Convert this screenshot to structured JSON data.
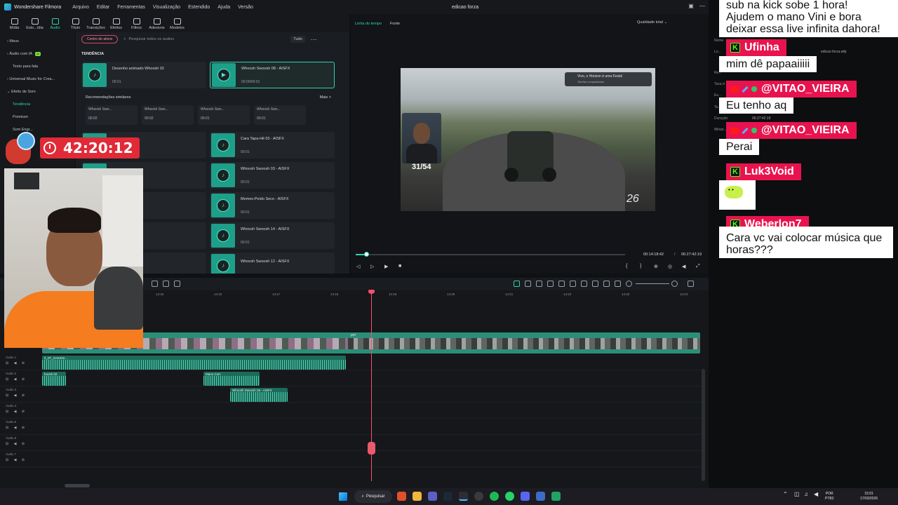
{
  "titlebar": {
    "app_name": "Wonder­share Filmora",
    "menu": [
      "Arquivo",
      "Editar",
      "Ferramentas",
      "Visualização",
      "Estendido",
      "Ajuda",
      "Versão"
    ],
    "document_title": "edicao forza"
  },
  "toolbar": {
    "items": [
      "Mídia",
      "Esto...ídia",
      "Áudio",
      "Título",
      "Transições",
      "Efeitos",
      "Filtros",
      "Adesivos",
      "Modelos"
    ],
    "active": "Áudio"
  },
  "leftnav": {
    "items": [
      "Meus",
      "Áudio com IA",
      "Texto para fala",
      "Universal Music for Crea...",
      "Efeito de Som",
      "Tendência",
      "Premium",
      "Som Engr..."
    ],
    "ai_badge": "AI"
  },
  "assets": {
    "center_button": "Centro de ativos",
    "search_placeholder": "Pesquisar todos os áudios",
    "filter": "Tudo",
    "section": "TENDÊNCIA",
    "top_cards": [
      {
        "title": "Desenho animado Whoosh 02",
        "duration": "00:01"
      },
      {
        "title": "Whoosh Swoosh 08 - AISFX",
        "duration": "00:00/00:01"
      }
    ],
    "similar_title": "Recomendações similares",
    "similar_more": "Mais >",
    "similar": [
      {
        "title": "Whoosh Swo...",
        "duration": "00:02"
      },
      {
        "title": "Whoosh Swo...",
        "duration": "00:02"
      },
      {
        "title": "Whoosh Swo...",
        "duration": "00:01"
      },
      {
        "title": "Whoosh Swo...",
        "duration": "00:01"
      }
    ],
    "left_list": [
      {
        "title": "- AISFX",
        "duration": ""
      },
      {
        "title": "sh 06 - AISFX",
        "duration": ""
      },
      {
        "title": "Grito - AISFX",
        "duration": ""
      },
      {
        "title": "- AISFX",
        "duration": ""
      },
      {
        "title": "m - AISFX",
        "duration": ""
      }
    ],
    "right_list": [
      {
        "title": "Cara Tapa-Hit 03 - AISFX",
        "duration": "00:01"
      },
      {
        "title": "Whoosh Swoosh 03 - AISFX",
        "duration": "00:01"
      },
      {
        "title": "Memes-Peido Seco - AISFX",
        "duration": "00:01"
      },
      {
        "title": "Whoosh Swoosh 14 - AISFX",
        "duration": "00:01"
      },
      {
        "title": "Whoosh Swoosh 12 - AISFX",
        "duration": ""
      }
    ]
  },
  "preview": {
    "tabs": [
      "Linha do tempo",
      "Fonte"
    ],
    "quality": "Qualidade total",
    "notification_title": "Vivo, o Horizon é uma Festa!",
    "notification_sub": "Tarefas conquistadas",
    "counter": "31/54",
    "speed": "26",
    "current_time": "00:14:18:42",
    "separator": "/",
    "total_time": "06:27:42:19",
    "progress": 0.04
  },
  "timeline": {
    "ruler": [
      "14:15",
      "14:16",
      "14:17",
      "14:18",
      "14:19",
      "14:20",
      "14:21",
      "14:22",
      "14:23",
      "14:24"
    ],
    "video_clip_label": "p07",
    "audio_tracks": [
      "Áudio 1",
      "Áudio 2",
      "Áudio 3",
      "Áudio 4",
      "Áudio 5",
      "Áudio 6",
      "Áudio 7"
    ],
    "audio_clips": [
      {
        "label": "0_0T_SAE402...",
        "track": 1
      },
      {
        "label": "hoosh 02",
        "track": 2
      },
      {
        "label": "Mario Coin",
        "track": 2
      },
      {
        "label": "Whoosh Swoosh 26 - AISFX",
        "track": 3
      }
    ]
  },
  "overlay": {
    "timer": "42:20:12"
  },
  "properties": {
    "rows": [
      {
        "label": "Nome",
        "value": ""
      },
      {
        "label": "Lo...",
        "value": "edicao forza.wfp"
      },
      {
        "label": "Re...",
        "value": ""
      },
      {
        "label": "Taxa d",
        "value": ""
      },
      {
        "label": "Es...",
        "value": ""
      },
      {
        "label": "Ta...",
        "value": "06:27:42:19"
      },
      {
        "label": "Duração:",
        "value": "06:27:42:19"
      },
      {
        "label": "Miniat...",
        "value": ""
      }
    ]
  },
  "chat": {
    "top_text": "sub na kick sobe 1 hora!\nAjudem o mano Vini e bora\ndeixar essa live infinita dahora!",
    "messages": [
      {
        "name": "Ufinha",
        "platform": "kick",
        "text": "mim dê papaaiiiii"
      },
      {
        "name": "@VITAO_VIEIRA",
        "platform": "youtube",
        "text": "Eu tenho aq"
      },
      {
        "name": "@VITAO_VIEIRA",
        "platform": "youtube",
        "text": "Perai"
      },
      {
        "name": "Luk3Void",
        "platform": "kick",
        "text": ""
      },
      {
        "name": "Weberlon7",
        "platform": "kick",
        "text": "Cara vc vai colocar música que\nhoras???"
      }
    ]
  },
  "taskbar": {
    "search": "Pesquisar",
    "lang": "POR",
    "layout": "PTB2",
    "time": "15:01",
    "date": "17/03/2026"
  },
  "colors": {
    "accent": "#2fd3b0",
    "chat_name_bg": "#e8134e",
    "timer_bg": "#e12a37",
    "playhead": "#ff4d6a"
  }
}
